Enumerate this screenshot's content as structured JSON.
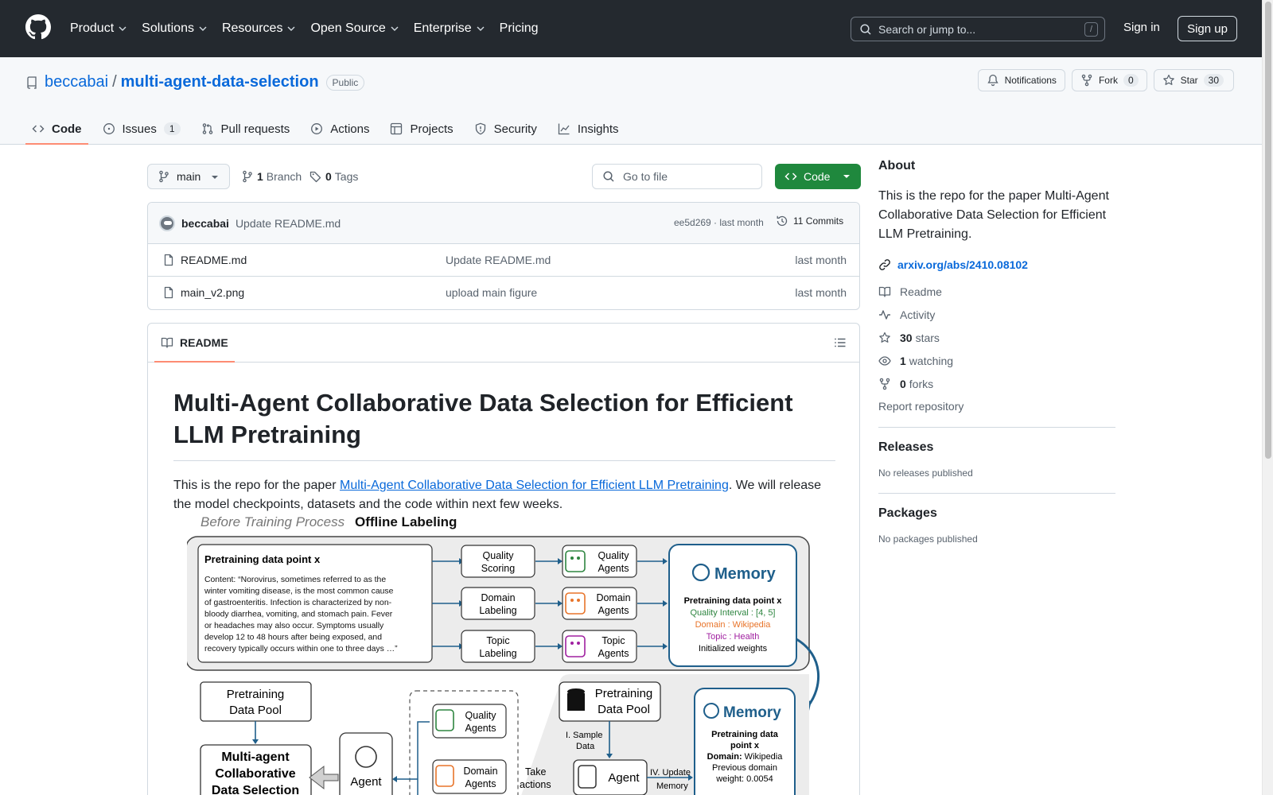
{
  "header": {
    "nav": [
      "Product",
      "Solutions",
      "Resources",
      "Open Source",
      "Enterprise",
      "Pricing"
    ],
    "search_placeholder": "Search or jump to...",
    "search_shortcut": "/",
    "sign_in": "Sign in",
    "sign_up": "Sign up"
  },
  "repo": {
    "owner": "beccabai",
    "separator": "/",
    "name": "multi-agent-data-selection",
    "visibility": "Public",
    "notifications_label": "Notifications",
    "fork_label": "Fork",
    "fork_count": "0",
    "star_label": "Star",
    "star_count": "30"
  },
  "tabs": {
    "code": "Code",
    "issues": "Issues",
    "issues_count": "1",
    "pulls": "Pull requests",
    "actions": "Actions",
    "projects": "Projects",
    "security": "Security",
    "insights": "Insights"
  },
  "toolbar": {
    "branch": "main",
    "branch_count": "1",
    "branch_label": "Branch",
    "tag_count": "0",
    "tag_label": "Tags",
    "goto_placeholder": "Go to file",
    "code_label": "Code"
  },
  "commit": {
    "author": "beccabai",
    "message": "Update README.md",
    "sha_time": "ee5d269 · last month",
    "commits_label": "11 Commits"
  },
  "files": [
    {
      "name": "README.md",
      "message": "Update README.md",
      "date": "last month"
    },
    {
      "name": "main_v2.png",
      "message": "upload main figure",
      "date": "last month"
    }
  ],
  "readme": {
    "tab": "README",
    "title": "Multi-Agent Collaborative Data Selection for Efficient LLM Pretraining",
    "intro_before": "This is the repo for the paper ",
    "intro_link": "Multi-Agent Collaborative Data Selection for Efficient LLM Pretraining",
    "intro_after": ". We will release the model checkpoints, datasets and the code within next few weeks."
  },
  "figure": {
    "before_title_italic": "Before Training Process",
    "before_title_bold": "Offline Labeling",
    "datapoint_title": "Pretraining data point x",
    "content_lines": [
      "Content: “Norovirus, sometimes referred to as the",
      "winter vomiting disease, is the most common cause",
      "of gastroenteritis. Infection is characterized by non-",
      "bloody diarrhea, vomiting, and stomach pain. Fever",
      "or headaches may also occur. Symptoms usually",
      "develop 12 to 48 hours after being exposed, and",
      "recovery typically occurs within one to three days …”"
    ],
    "tasks": [
      {
        "line1": "Quality",
        "line2": "Scoring",
        "agent1": "Quality",
        "agent2": "Agents"
      },
      {
        "line1": "Domain",
        "line2": "Labeling",
        "agent1": "Domain",
        "agent2": "Agents"
      },
      {
        "line1": "Topic",
        "line2": "Labeling",
        "agent1": "Topic",
        "agent2": "Agents"
      }
    ],
    "memory_title": "Memory",
    "memory_dp": "Pretraining data point x",
    "memory_quality": "Quality Interval : [4, 5]",
    "memory_domain": "Domain : Wikipedia",
    "memory_topic": "Topic : Health",
    "memory_weights": "Initialized weights",
    "pool_line1": "Pretraining",
    "pool_line2": "Data Pool",
    "mac_line1": "Multi-agent",
    "mac_line2": "Collaborative",
    "mac_line3": "Data Selection",
    "agent_label": "Agent",
    "quality_agents_1": "Quality",
    "quality_agents_2": "Agents",
    "domain_agents_1": "Domain",
    "domain_agents_2": "Agents",
    "take_actions_1": "Take",
    "take_actions_2": "actions",
    "pool2_line1": "Pretraining",
    "pool2_line2": "Data Pool",
    "sample_1": "I. Sample",
    "sample_2": "Data",
    "agent2_label": "Agent",
    "update_1": "IV. Update",
    "update_2": "Memory",
    "memory2_title": "Memory",
    "m2_line1": "Pretraining data",
    "m2_line2": "point x",
    "m2_line3_bold": "Domain:",
    "m2_line3": " Wikipedia",
    "m2_line4": "Previous domain",
    "m2_line5": "weight: 0.0054",
    "colors": {
      "quality": "#2e8540",
      "domain": "#e8742a",
      "topic": "#a020a0",
      "memory": "#1f5f8b"
    }
  },
  "sidebar": {
    "about": "About",
    "description": "This is the repo for the paper Multi-Agent Collaborative Data Selection for Efficient LLM Pretraining.",
    "link": "arxiv.org/abs/2410.08102",
    "readme": "Readme",
    "activity": "Activity",
    "stars_count": "30",
    "stars_label": "stars",
    "watching_count": "1",
    "watching_label": "watching",
    "forks_count": "0",
    "forks_label": "forks",
    "report": "Report repository",
    "releases_title": "Releases",
    "releases_empty": "No releases published",
    "packages_title": "Packages",
    "packages_empty": "No packages published"
  }
}
